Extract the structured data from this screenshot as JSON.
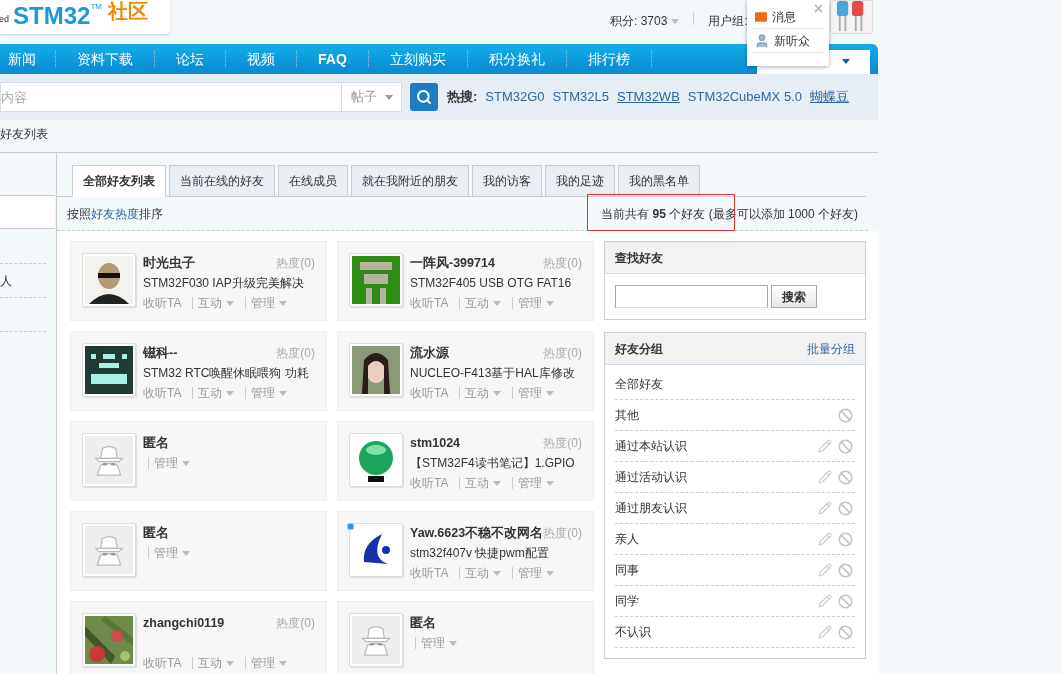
{
  "logo": {
    "cut_text": "ed",
    "name": "STM32",
    "trademark": "TM",
    "suffix": "社区"
  },
  "user_bar": {
    "points": "积分: 3703",
    "group_label": "用户组:"
  },
  "notice_popup": {
    "close": "×",
    "items": [
      {
        "kind": "mail",
        "label": "消息"
      },
      {
        "kind": "person",
        "label": "新听众"
      }
    ]
  },
  "nav": {
    "items": [
      {
        "label": "新闻",
        "bold": false
      },
      {
        "label": "资料下载",
        "bold": false
      },
      {
        "label": "论坛",
        "bold": false
      },
      {
        "label": "视频",
        "bold": false
      },
      {
        "label": "FAQ",
        "bold": true
      },
      {
        "label": "立刻购买",
        "bold": false
      },
      {
        "label": "积分换礼",
        "bold": false
      },
      {
        "label": "排行榜",
        "bold": false
      }
    ]
  },
  "search": {
    "placeholder": "内容",
    "scope": "帖子",
    "hot_label": "热搜:",
    "hot_links": [
      {
        "label": "STM32G0",
        "underlined": false
      },
      {
        "label": "STM32L5",
        "underlined": false
      },
      {
        "label": "STM32WB",
        "underlined": true
      },
      {
        "label": "STM32CubeMX 5.0",
        "underlined": false
      },
      {
        "label": "蝴蝶豆",
        "underlined": true
      }
    ]
  },
  "breadcrumb": "好友列表",
  "sidebar": {
    "item_text": "人"
  },
  "tabs": [
    {
      "label": "全部好友列表",
      "selected": true
    },
    {
      "label": "当前在线的好友",
      "selected": false
    },
    {
      "label": "在线成员",
      "selected": false
    },
    {
      "label": "就在我附近的朋友",
      "selected": false
    },
    {
      "label": "我的访客",
      "selected": false
    },
    {
      "label": "我的足迹",
      "selected": false
    },
    {
      "label": "我的黑名单",
      "selected": false
    }
  ],
  "sort": {
    "prefix": "按照",
    "link": "好友热度",
    "suffix": "排序"
  },
  "summary": "当前共有 **95** 个好友 (最多可以添加 1000 个好友)",
  "friends": [
    {
      "kind": "member",
      "name": "时光虫子",
      "heat": "热度(0)",
      "signature": "STM32F030 IAP升级完美解决",
      "badge": false,
      "actions": [
        {
          "label": "收听TA",
          "dropdown": false
        },
        {
          "label": "互动",
          "dropdown": true
        },
        {
          "label": "管理",
          "dropdown": true
        }
      ]
    },
    {
      "kind": "member",
      "name": "一阵风-399714",
      "heat": "热度(0)",
      "signature": "STM32F405 USB OTG FAT16",
      "badge": false,
      "actions": [
        {
          "label": "收听TA",
          "dropdown": false
        },
        {
          "label": "互动",
          "dropdown": true
        },
        {
          "label": "管理",
          "dropdown": true
        }
      ]
    },
    {
      "kind": "member",
      "name": "镃科--",
      "heat": "热度(0)",
      "signature": "STM32 RTC唤醒休眠喂狗 功耗",
      "badge": false,
      "actions": [
        {
          "label": "收听TA",
          "dropdown": false
        },
        {
          "label": "互动",
          "dropdown": true
        },
        {
          "label": "管理",
          "dropdown": true
        }
      ]
    },
    {
      "kind": "member",
      "name": "流水源",
      "heat": "热度(0)",
      "signature": "NUCLEO-F413基于HAL库修改",
      "badge": false,
      "actions": [
        {
          "label": "收听TA",
          "dropdown": false
        },
        {
          "label": "互动",
          "dropdown": true
        },
        {
          "label": "管理",
          "dropdown": true
        }
      ]
    },
    {
      "kind": "anonymous",
      "name": "匿名",
      "badge": false,
      "actions": [
        {
          "label": "管理",
          "dropdown": true
        }
      ]
    },
    {
      "kind": "member",
      "name": "stm1024",
      "heat": "热度(0)",
      "signature": "【STM32F4读书笔记】1.GPIO",
      "badge": false,
      "actions": [
        {
          "label": "收听TA",
          "dropdown": false
        },
        {
          "label": "互动",
          "dropdown": true
        },
        {
          "label": "管理",
          "dropdown": true
        }
      ]
    },
    {
      "kind": "anonymous",
      "name": "匿名",
      "badge": false,
      "actions": [
        {
          "label": "管理",
          "dropdown": true
        }
      ]
    },
    {
      "kind": "member",
      "name": "Yaw.6623不稳不改网名",
      "heat": "热度(0)",
      "signature": "stm32f407v 快捷pwm配置",
      "badge": true,
      "actions": [
        {
          "label": "收听TA",
          "dropdown": false
        },
        {
          "label": "互动",
          "dropdown": true
        },
        {
          "label": "管理",
          "dropdown": true
        }
      ]
    },
    {
      "kind": "member",
      "name": "zhangchi0119",
      "heat": "热度(0)",
      "badge": false,
      "actions": [
        {
          "label": "收听TA",
          "dropdown": false
        },
        {
          "label": "互动",
          "dropdown": true
        },
        {
          "label": "管理",
          "dropdown": true
        }
      ]
    },
    {
      "kind": "anonymous",
      "name": "匿名",
      "badge": false,
      "actions": [
        {
          "label": "管理",
          "dropdown": true
        }
      ]
    }
  ],
  "find_friend": {
    "title": "查找好友",
    "button": "搜索"
  },
  "groups": {
    "title": "好友分组",
    "action": "批量分组",
    "items": [
      {
        "label": "全部好友",
        "editable": false,
        "deletable": false
      },
      {
        "label": "其他",
        "editable": false,
        "deletable": true
      },
      {
        "label": "通过本站认识",
        "editable": true,
        "deletable": true
      },
      {
        "label": "通过活动认识",
        "editable": true,
        "deletable": true
      },
      {
        "label": "通过朋友认识",
        "editable": true,
        "deletable": true
      },
      {
        "label": "亲人",
        "editable": true,
        "deletable": true
      },
      {
        "label": "同事",
        "editable": true,
        "deletable": true
      },
      {
        "label": "同学",
        "editable": true,
        "deletable": true
      },
      {
        "label": "不认识",
        "editable": true,
        "deletable": true
      }
    ]
  }
}
